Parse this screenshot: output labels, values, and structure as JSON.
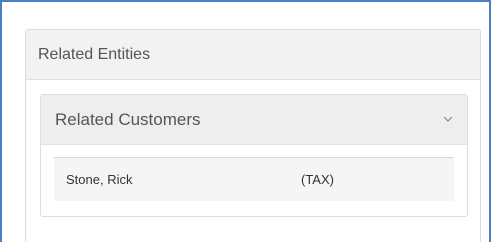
{
  "panel": {
    "title": "Related Entities"
  },
  "related_customers": {
    "title": "Related Customers",
    "toggle_icon": "chevron-down-icon",
    "rows": [
      {
        "name": "Stone, Rick",
        "role": "(TAX)"
      }
    ]
  },
  "colors": {
    "frame_border": "#4a7ec7",
    "header_bg": "#f2f2f2",
    "row_bg": "#f5f5f5"
  }
}
